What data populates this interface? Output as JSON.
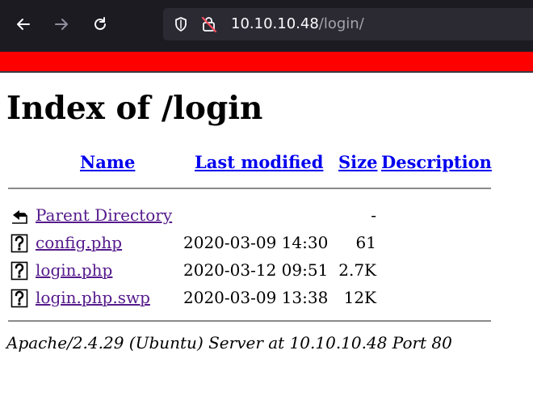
{
  "browser": {
    "url_host": "10.10.10.48",
    "url_path": "/login/",
    "icons": [
      "back-arrow-icon",
      "forward-arrow-icon",
      "reload-icon",
      "shield-icon",
      "insecure-lock-icon"
    ],
    "colors": {
      "toolbar": "#1c1b22",
      "urlbar": "#2b2a33",
      "banner": "#ff0000"
    }
  },
  "page": {
    "title": "Index of /login",
    "columns": {
      "name": "Name",
      "last_modified": "Last modified",
      "size": "Size",
      "description": "Description"
    },
    "rows": [
      {
        "icon": "back-folder-icon",
        "name": "Parent Directory",
        "modified": "",
        "size": "-"
      },
      {
        "icon": "unknown-file-icon",
        "name": "config.php",
        "modified": "2020-03-09 14:30",
        "size": "61"
      },
      {
        "icon": "unknown-file-icon",
        "name": "login.php",
        "modified": "2020-03-12 09:51",
        "size": "2.7K"
      },
      {
        "icon": "unknown-file-icon",
        "name": "login.php.swp",
        "modified": "2020-03-09 13:38",
        "size": "12K"
      }
    ],
    "server_signature": "Apache/2.4.29 (Ubuntu) Server at 10.10.10.48 Port 80"
  }
}
